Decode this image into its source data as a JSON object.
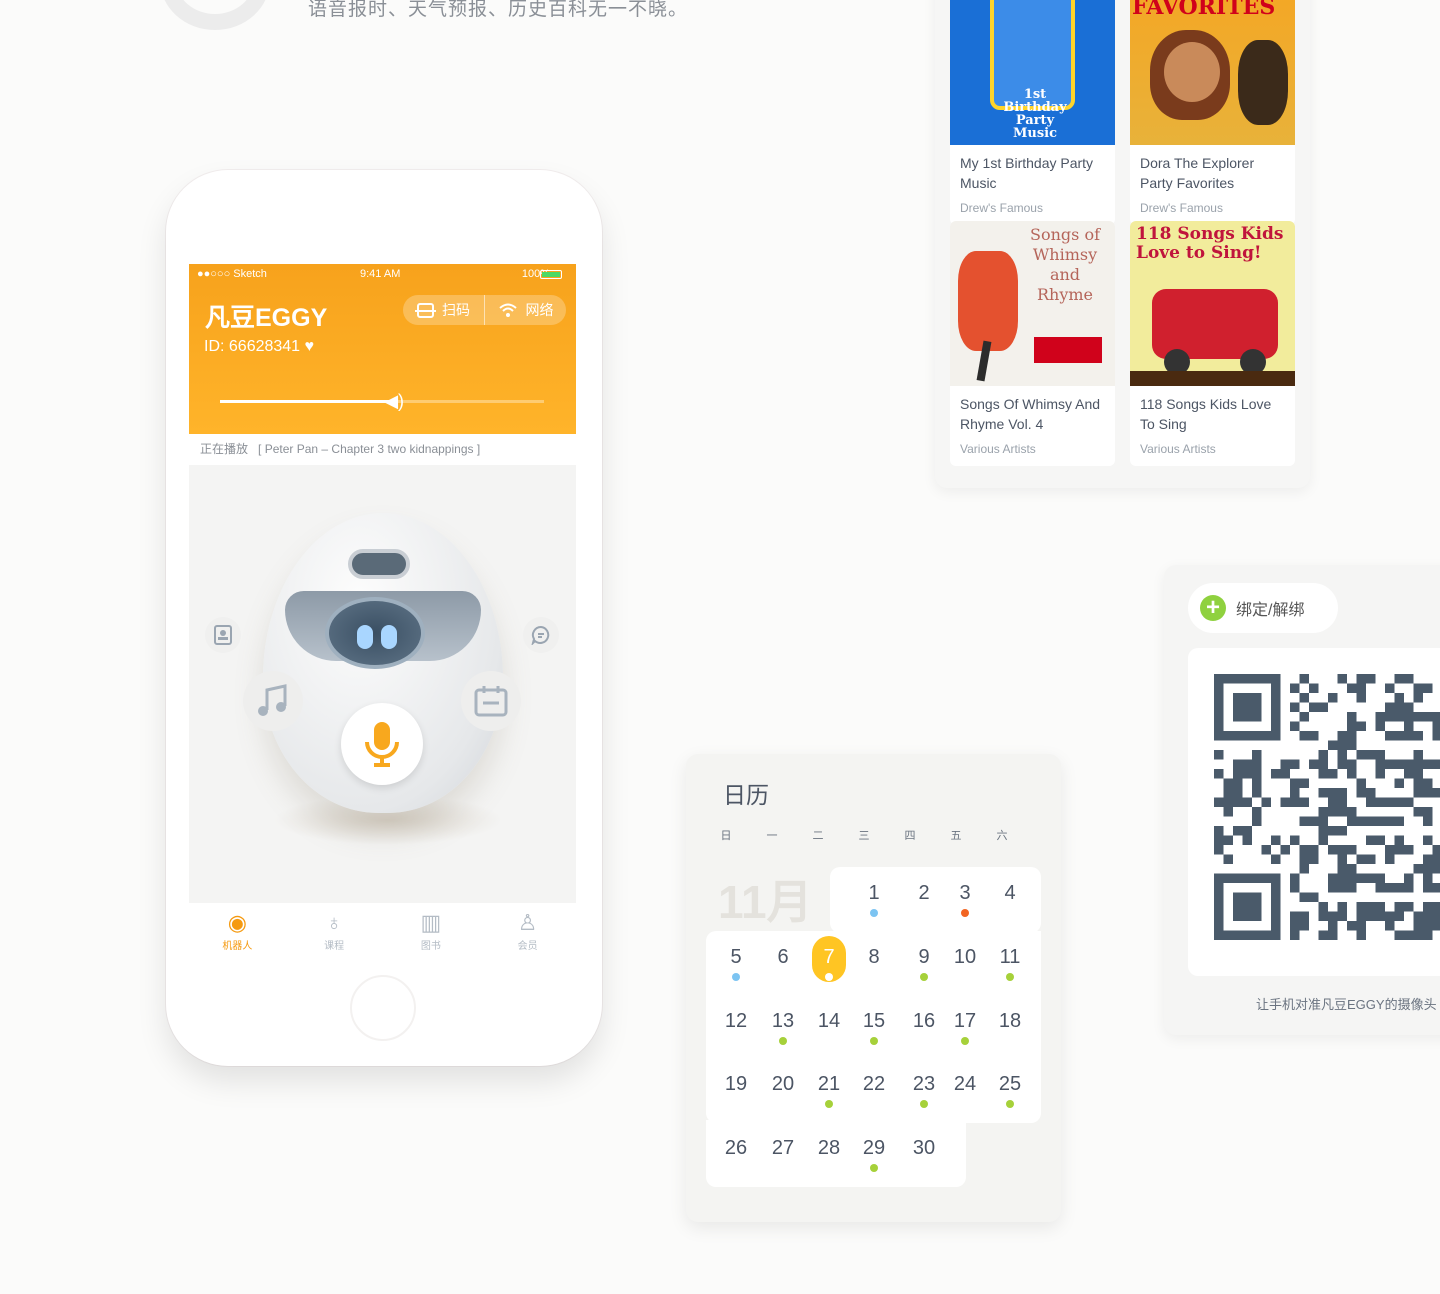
{
  "intro": {
    "text": "语音报时、天气预报、历史百科无一不晓。"
  },
  "phone": {
    "status": {
      "carrier": "●●○○○ Sketch",
      "time": "9:41 AM",
      "battery": "100%"
    },
    "app_name": "凡豆EGGY",
    "device_id": "ID: 66628341",
    "scan_label": "扫码",
    "network_label": "网络",
    "volume_level": 0.55,
    "now_playing_label": "正在播放",
    "now_playing_track": "[ Peter Pan – Chapter 3 two kidnappings ]",
    "tabs": [
      {
        "label": "机器人",
        "icon": "robot-icon"
      },
      {
        "label": "课程",
        "icon": "bulb-icon"
      },
      {
        "label": "图书",
        "icon": "book-icon"
      },
      {
        "label": "会员",
        "icon": "user-icon"
      }
    ],
    "accent_color": "#f7a21c"
  },
  "music": {
    "albums": [
      {
        "title": "My 1st Birthday Party Music",
        "artist": "Drew's Famous",
        "cover_text": "1st Birthday Party Music"
      },
      {
        "title": "Dora The Explorer Party Favorites",
        "artist": "Drew's Famous",
        "cover_text": "FAVORITES"
      },
      {
        "title": "Songs Of Whimsy And Rhyme Vol. 4",
        "artist": "Various Artists",
        "cover_text": "Songs of Whimsy and Rhyme"
      },
      {
        "title": "118 Songs Kids Love To Sing",
        "artist": "Various Artists",
        "cover_text": "118 Songs Kids Love to Sing!"
      }
    ]
  },
  "calendar": {
    "title": "日历",
    "weekdays": [
      "日",
      "一",
      "二",
      "三",
      "四",
      "五",
      "六"
    ],
    "month": "11月",
    "today": 7,
    "days": [
      "1",
      "2",
      "3",
      "4",
      "5",
      "6",
      "7",
      "8",
      "9",
      "10",
      "11",
      "12",
      "13",
      "14",
      "15",
      "16",
      "17",
      "18",
      "19",
      "20",
      "21",
      "22",
      "23",
      "24",
      "25",
      "26",
      "27",
      "28",
      "29",
      "30"
    ],
    "dot_colors": {
      "blue": "#7cc4f2",
      "orange": "#f26522",
      "green": "#a6d13a"
    }
  },
  "qr": {
    "bind_label": "绑定/解绑",
    "hint": "让手机对准凡豆EGGY的摄像头"
  }
}
